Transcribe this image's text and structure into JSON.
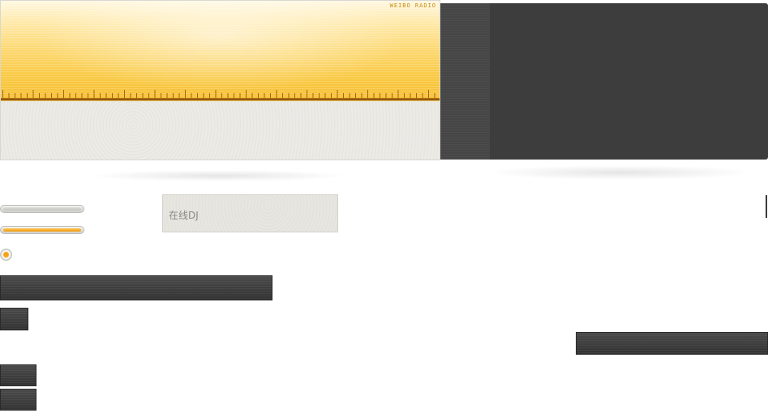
{
  "tuner": {
    "brand_text": "WEIBO RADIO",
    "accent_color": "#f9c840",
    "scale_color": "#a0670f"
  },
  "dj_card": {
    "label": "在线DJ"
  },
  "volume": {
    "level": 0.0
  },
  "playback": {
    "progress": 1.0,
    "fill_color": "#f09a14"
  },
  "side_panel": {
    "color": "#3d3d3d"
  }
}
